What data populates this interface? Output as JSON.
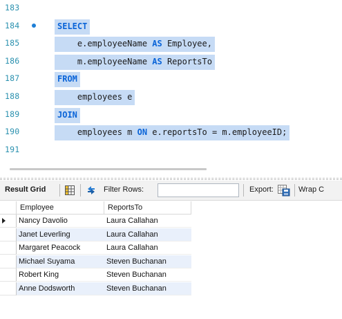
{
  "editor": {
    "lines": [
      {
        "num": "183",
        "code": ""
      },
      {
        "num": "184",
        "code": "SELECT"
      },
      {
        "num": "185",
        "code": "    e.employeeName AS Employee,"
      },
      {
        "num": "186",
        "code": "    m.employeeName AS ReportsTo"
      },
      {
        "num": "187",
        "code": "FROM"
      },
      {
        "num": "188",
        "code": "    employees e"
      },
      {
        "num": "189",
        "code": "JOIN"
      },
      {
        "num": "190",
        "code": "    employees m ON e.reportsTo = m.employeeID;"
      },
      {
        "num": "191",
        "code": ""
      }
    ],
    "keywords": [
      "SELECT",
      "FROM",
      "JOIN",
      "AS",
      "ON"
    ],
    "colors": {
      "keyword": "#0a64d8",
      "line_number": "#2b91af",
      "selection": "#c6dbf5",
      "bullet": "#1e7fd6"
    }
  },
  "toolbar": {
    "result_grid_label": "Result Grid",
    "filter_rows_label": "Filter Rows:",
    "filter_rows_value": "",
    "export_label": "Export:",
    "wrap_label": "Wrap C",
    "icons": [
      "grid-layout-icon",
      "refresh-arrows-icon",
      "export-file-icon"
    ]
  },
  "grid": {
    "columns": [
      "Employee",
      "ReportsTo"
    ],
    "rows": [
      [
        "Nancy Davolio",
        "Laura Callahan"
      ],
      [
        "Janet Leverling",
        "Laura Callahan"
      ],
      [
        "Margaret Peacock",
        "Laura Callahan"
      ],
      [
        "Michael Suyama",
        "Steven Buchanan"
      ],
      [
        "Robert King",
        "Steven Buchanan"
      ],
      [
        "Anne Dodsworth",
        "Steven Buchanan"
      ]
    ],
    "selected_row_pointer": 0,
    "alt_row_color": "#e9f0fb"
  }
}
